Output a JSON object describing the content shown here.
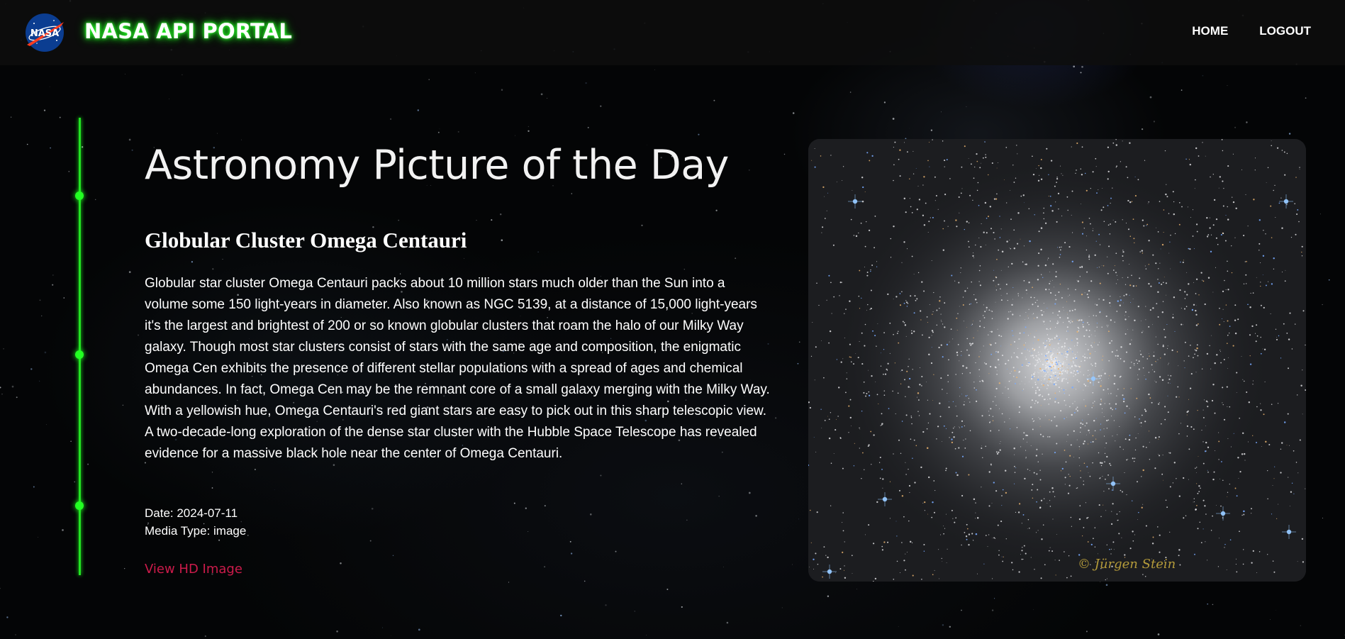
{
  "header": {
    "logo_text": "NASA",
    "brand_title": "NASA API PORTAL",
    "nav": [
      {
        "label": "HOME"
      },
      {
        "label": "LOGOUT"
      }
    ]
  },
  "main": {
    "page_title": "Astronomy Picture of the Day",
    "apod": {
      "title": "Globular Cluster Omega Centauri",
      "explanation": "Globular star cluster Omega Centauri packs about 10 million stars much older than the Sun into a volume some 150 light-years in diameter. Also known as NGC 5139, at a distance of 15,000 light-years it's the largest and brightest of 200 or so known globular clusters that roam the halo of our Milky Way galaxy. Though most star clusters consist of stars with the same age and composition, the enigmatic Omega Cen exhibits the presence of different stellar populations with a spread of ages and chemical abundances. In fact, Omega Cen may be the remnant core of a small galaxy merging with the Milky Way. With a yellowish hue, Omega Centauri's red giant stars are easy to pick out in this sharp telescopic view. A two-decade-long exploration of the dense star cluster with the Hubble Space Telescope has revealed evidence for a massive black hole near the center of Omega Centauri.",
      "date_text": "Date: 2024-07-11",
      "media_type_text": "Media Type: image",
      "hd_link_label": "View HD Image",
      "image_credit": "© Jürgen Stein"
    }
  },
  "colors": {
    "accent_green": "#22e322",
    "link_red": "#cc1b4b",
    "background": "#040506",
    "header_bg": "#0e0e0e"
  },
  "icons": {
    "logo": "nasa-meatball-logo"
  }
}
